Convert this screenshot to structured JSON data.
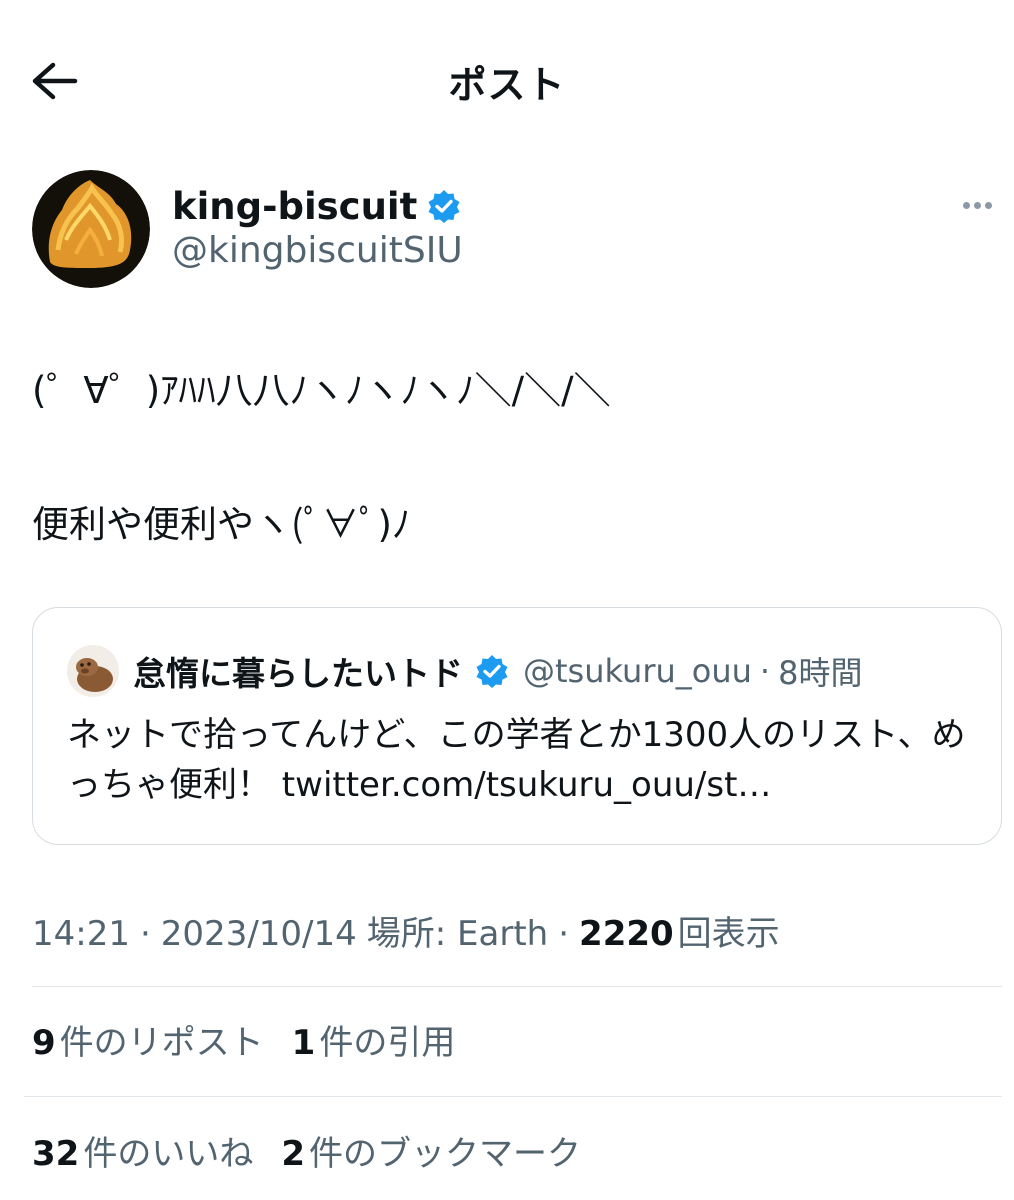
{
  "header": {
    "title": "ポスト"
  },
  "author": {
    "name": "king-biscuit",
    "handle": "@kingbiscuitSIU"
  },
  "tweet": {
    "line1": "(゜∀゜)ｱﾊﾊ八八ﾉヽﾉヽﾉヽﾉ＼/＼/＼",
    "line2": "便利や便利やヽ(ﾟ∀ﾟ)ﾉ"
  },
  "quote": {
    "name": "怠惰に暮らしたいトド",
    "handle": "@tsukuru_ouu",
    "dot": "·",
    "time": "8時間",
    "text": "ネットで拾ってんけど、この学者とか1300人のリスト、めっちゃ便利！ twitter.com/tsukuru_ouu/st…"
  },
  "meta": {
    "time": "14:21",
    "sep1": "·",
    "date": "2023/10/14",
    "location": "場所: Earth",
    "sep2": "·",
    "views_count": "2220",
    "views_label": "回表示"
  },
  "stats": {
    "reposts_count": "9",
    "reposts_label": "件のリポスト",
    "quotes_count": "1",
    "quotes_label": "件の引用",
    "likes_count": "32",
    "likes_label": "件のいいね",
    "bookmarks_count": "2",
    "bookmarks_label": "件のブックマーク"
  },
  "colors": {
    "verified": "#1d9bf0",
    "secondary_text": "#536471",
    "primary_text": "#0f1419",
    "border": "#d6dce0"
  }
}
